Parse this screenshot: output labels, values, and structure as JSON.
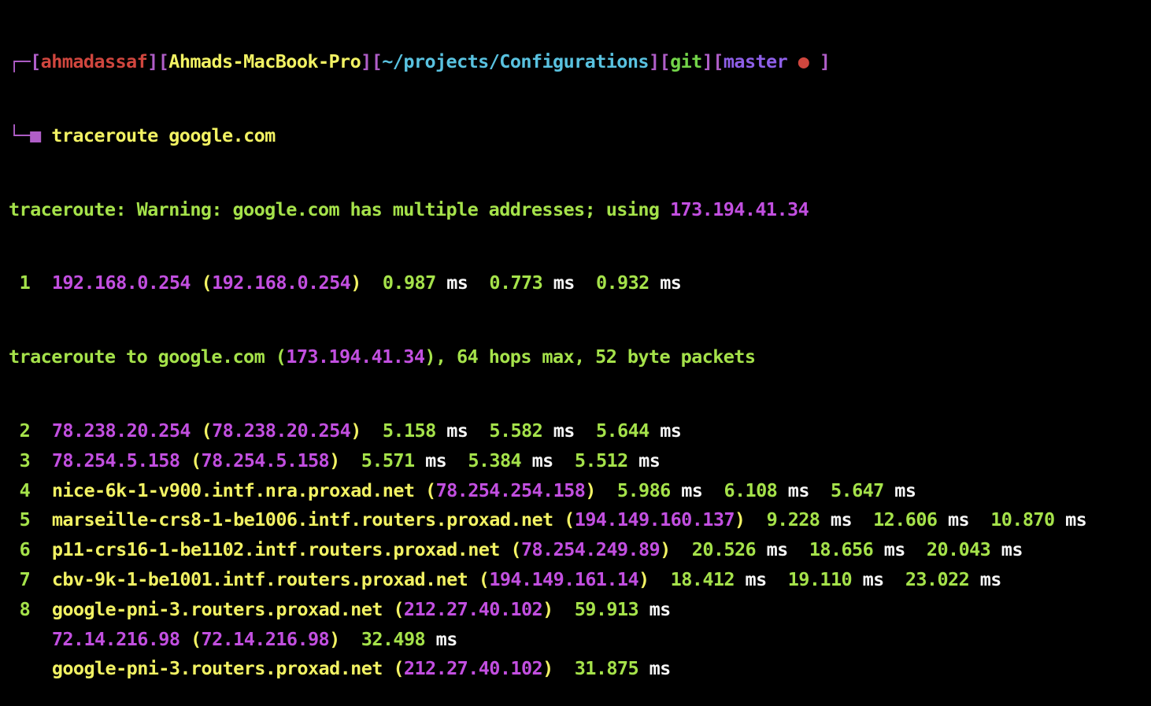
{
  "colors": {
    "background": "#000000",
    "prompt_bracket": "#b05ec8",
    "user": "#d0463e",
    "host": "#f2f263",
    "path": "#59c2e0",
    "git": "#73d449",
    "branch": "#8e5fe8",
    "info_text": "#a5e24a",
    "ip_address": "#c24fe0",
    "hostname": "#f2f263",
    "timing": "#a5e24a",
    "unit": "#f6f6f6"
  },
  "prompt": {
    "corner_top": "┌─",
    "user": "ahmadassaf",
    "host": "Ahmads-MacBook-Pro",
    "path": "~/projects/Configurations",
    "vcs": "git",
    "branch": "master",
    "dirty_marker": "●",
    "corner_bottom": "└─■",
    "command": "traceroute google.com"
  },
  "warning": {
    "text": "traceroute: Warning: google.com has multiple addresses; using ",
    "address": "173.194.41.34"
  },
  "header": {
    "prefix": "traceroute to google.com (",
    "address": "173.194.41.34",
    "suffix": "), 64 hops max, 52 byte packets"
  },
  "unit": "ms",
  "hops_before_header": [
    {
      "hop": "1",
      "host": "192.168.0.254",
      "host_is_ip": true,
      "ip": "192.168.0.254",
      "times": [
        "0.987",
        "0.773",
        "0.932"
      ]
    }
  ],
  "hops": [
    {
      "hop": "2",
      "host": "78.238.20.254",
      "host_is_ip": true,
      "ip": "78.238.20.254",
      "times": [
        "5.158",
        "5.582",
        "5.644"
      ]
    },
    {
      "hop": "3",
      "host": "78.254.5.158",
      "host_is_ip": true,
      "ip": "78.254.5.158",
      "times": [
        "5.571",
        "5.384",
        "5.512"
      ]
    },
    {
      "hop": "4",
      "host": "nice-6k-1-v900.intf.nra.proxad.net",
      "host_is_ip": false,
      "ip": "78.254.254.158",
      "times": [
        "5.986",
        "6.108",
        "5.647"
      ]
    },
    {
      "hop": "5",
      "host": "marseille-crs8-1-be1006.intf.routers.proxad.net",
      "host_is_ip": false,
      "ip": "194.149.160.137",
      "times": [
        "9.228",
        "12.606",
        "10.870"
      ]
    },
    {
      "hop": "6",
      "host": "p11-crs16-1-be1102.intf.routers.proxad.net",
      "host_is_ip": false,
      "ip": "78.254.249.89",
      "times": [
        "20.526",
        "18.656",
        "20.043"
      ]
    },
    {
      "hop": "7",
      "host": "cbv-9k-1-be1001.intf.routers.proxad.net",
      "host_is_ip": false,
      "ip": "194.149.161.14",
      "times": [
        "18.412",
        "19.110",
        "23.022"
      ]
    },
    {
      "hop": "8",
      "host": "google-pni-3.routers.proxad.net",
      "host_is_ip": false,
      "ip": "212.27.40.102",
      "times": [
        "59.913"
      ]
    },
    {
      "hop": "",
      "host": "72.14.216.98",
      "host_is_ip": true,
      "ip": "72.14.216.98",
      "times": [
        "32.498"
      ]
    },
    {
      "hop": "",
      "host": "google-pni-3.routers.proxad.net",
      "host_is_ip": false,
      "ip": "212.27.40.102",
      "times": [
        "31.875"
      ]
    }
  ]
}
